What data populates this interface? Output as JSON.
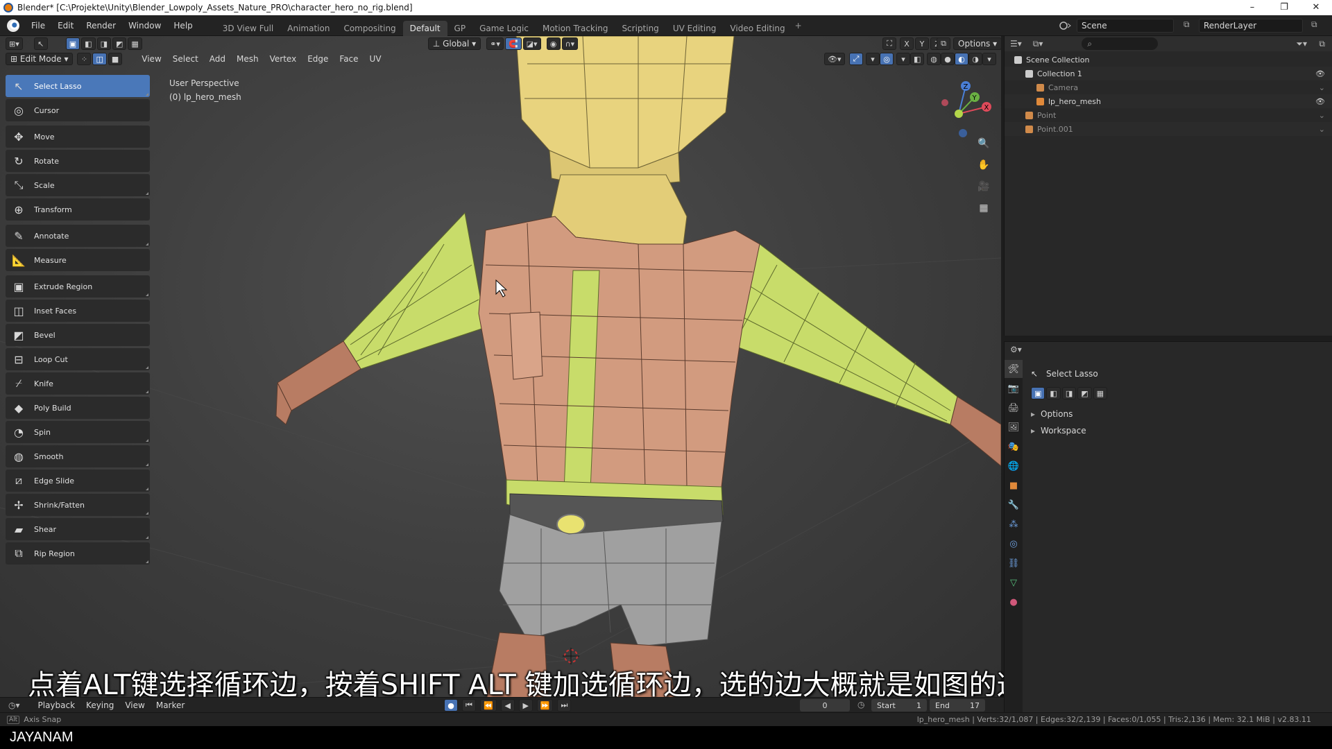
{
  "titlebar": {
    "title": "Blender* [C:\\Projekte\\Unity\\Blender_Lowpoly_Assets_Nature_PRO\\character_hero_no_rig.blend]",
    "minimize": "–",
    "maximize": "❐",
    "close": "✕"
  },
  "menu": [
    "File",
    "Edit",
    "Render",
    "Window",
    "Help"
  ],
  "workspaces": [
    "3D View Full",
    "Animation",
    "Compositing",
    "Default",
    "GP",
    "Game Logic",
    "Motion Tracking",
    "Scripting",
    "UV Editing",
    "Video Editing"
  ],
  "workspace_active": "Default",
  "workspace_add": "+",
  "scene": {
    "name": "Scene",
    "render_layer": "RenderLayer"
  },
  "viewport": {
    "mode": "Edit Mode",
    "menus": [
      "View",
      "Select",
      "Add",
      "Mesh",
      "Vertex",
      "Edge",
      "Face",
      "UV"
    ],
    "transform_orientation": "Global",
    "axes": [
      "X",
      "Y",
      "Z"
    ],
    "options_label": "Options",
    "info_line1": "User Perspective",
    "info_line2": "(0) lp_hero_mesh"
  },
  "toolbar": [
    {
      "label": "Select Lasso",
      "icon": "select-lasso-icon",
      "glyph": "↖",
      "active": true,
      "corner": true
    },
    {
      "label": "Cursor",
      "icon": "cursor-icon",
      "glyph": "◎",
      "corner": false
    },
    {
      "label": "Move",
      "icon": "move-icon",
      "glyph": "✥",
      "corner": false,
      "gap": true
    },
    {
      "label": "Rotate",
      "icon": "rotate-icon",
      "glyph": "↻",
      "corner": false
    },
    {
      "label": "Scale",
      "icon": "scale-icon",
      "glyph": "⤡",
      "corner": true
    },
    {
      "label": "Transform",
      "icon": "transform-icon",
      "glyph": "⊕",
      "corner": false
    },
    {
      "label": "Annotate",
      "icon": "annotate-icon",
      "glyph": "✎",
      "corner": true,
      "gap": true
    },
    {
      "label": "Measure",
      "icon": "measure-icon",
      "glyph": "📐",
      "corner": false
    },
    {
      "label": "Extrude Region",
      "icon": "extrude-region-icon",
      "glyph": "▣",
      "corner": true,
      "gap": true
    },
    {
      "label": "Inset Faces",
      "icon": "inset-faces-icon",
      "glyph": "◫",
      "corner": false
    },
    {
      "label": "Bevel",
      "icon": "bevel-icon",
      "glyph": "◩",
      "corner": false
    },
    {
      "label": "Loop Cut",
      "icon": "loop-cut-icon",
      "glyph": "⊟",
      "corner": true
    },
    {
      "label": "Knife",
      "icon": "knife-icon",
      "glyph": "⌿",
      "corner": true
    },
    {
      "label": "Poly Build",
      "icon": "poly-build-icon",
      "glyph": "◆",
      "corner": false
    },
    {
      "label": "Spin",
      "icon": "spin-icon",
      "glyph": "◔",
      "corner": true
    },
    {
      "label": "Smooth",
      "icon": "smooth-icon",
      "glyph": "◍",
      "corner": true
    },
    {
      "label": "Edge Slide",
      "icon": "edge-slide-icon",
      "glyph": "⧄",
      "corner": true
    },
    {
      "label": "Shrink/Fatten",
      "icon": "shrink-fatten-icon",
      "glyph": "✢",
      "corner": true
    },
    {
      "label": "Shear",
      "icon": "shear-icon",
      "glyph": "▰",
      "corner": true
    },
    {
      "label": "Rip Region",
      "icon": "rip-region-icon",
      "glyph": "⧉",
      "corner": true
    }
  ],
  "subtitle": "点着ALT键选择循环边，按着SHIFT ALT 键加选循环边，选的边大概就是如图的这些大概关节部位的边",
  "timeline": {
    "menus": [
      "Playback",
      "Keying",
      "View",
      "Marker"
    ],
    "current_frame": "0",
    "start_label": "Start",
    "start_value": "1",
    "end_label": "End",
    "end_value": "17"
  },
  "statusbar": {
    "left": "Axis Snap",
    "right": "lp_hero_mesh | Verts:32/1,087 | Edges:32/2,139 | Faces:0/1,055 | Tris:2,136 | Mem: 32.1 MiB | v2.83.11"
  },
  "watermark": "JAYANAM",
  "outliner": {
    "items": [
      {
        "label": "Scene Collection",
        "indent": 0,
        "icon": "scene-collection-icon",
        "eye": false,
        "dim": false
      },
      {
        "label": "Collection 1",
        "indent": 1,
        "icon": "collection-icon",
        "eye": true,
        "dim": false
      },
      {
        "label": "Camera",
        "indent": 2,
        "icon": "camera-icon",
        "eye": false,
        "dim": true
      },
      {
        "label": "lp_hero_mesh",
        "indent": 2,
        "icon": "mesh-icon",
        "eye": true,
        "dim": false
      },
      {
        "label": "Point",
        "indent": 1,
        "icon": "light-icon",
        "eye": false,
        "dim": true
      },
      {
        "label": "Point.001",
        "indent": 1,
        "icon": "light-icon",
        "eye": false,
        "dim": true
      }
    ]
  },
  "properties": {
    "tool_name": "Select Lasso",
    "panels": [
      "Options",
      "Workspace"
    ]
  },
  "colors": {
    "accent": "#4772b3",
    "skin": "#b87c63",
    "shirt": "#d29b7f",
    "sleeve": "#c8dc6a",
    "head": "#e8d37e",
    "pants": "#a0a0a0"
  }
}
